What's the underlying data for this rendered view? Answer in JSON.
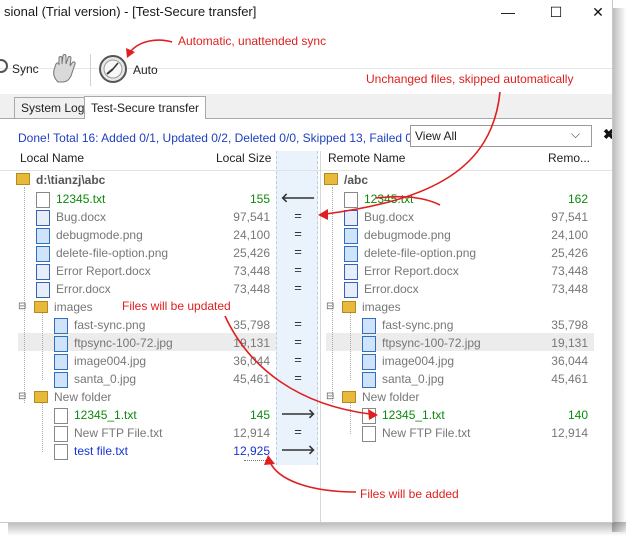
{
  "window": {
    "title": "sional (Trial version) - [Test-Secure transfer]",
    "minimize": "—",
    "maximize": "☐",
    "close": "✕"
  },
  "toolbar": {
    "sync_label": "Sync",
    "auto_label": "Auto"
  },
  "tabs": [
    {
      "label": "System Log"
    },
    {
      "label": "Test-Secure transfer"
    }
  ],
  "status": {
    "text": "Done!  Total 16: Added 0/1, Updated 0/2, Deleted 0/0, Skipped 13, Failed 0",
    "view_option": "View All"
  },
  "columns": {
    "local_name": "Local Name",
    "local_size": "Local Size",
    "remote_name": "Remote Name",
    "remote_size": "Remo..."
  },
  "rows": [
    {
      "local_name": "d:\\tianzj\\abc",
      "local_size": "",
      "mid": "",
      "remote_name": "/abc",
      "remote_size": ""
    },
    {
      "local_name": "12345.txt",
      "local_size": "155",
      "mid": "🡐",
      "remote_name": "12345.txt",
      "remote_size": "162"
    },
    {
      "local_name": "Bug.docx",
      "local_size": "97,541",
      "mid": "=",
      "remote_name": "Bug.docx",
      "remote_size": "97,541"
    },
    {
      "local_name": "debugmode.png",
      "local_size": "24,100",
      "mid": "=",
      "remote_name": "debugmode.png",
      "remote_size": "24,100"
    },
    {
      "local_name": "delete-file-option.png",
      "local_size": "25,426",
      "mid": "=",
      "remote_name": "delete-file-option.png",
      "remote_size": "25,426"
    },
    {
      "local_name": "Error Report.docx",
      "local_size": "73,448",
      "mid": "=",
      "remote_name": "Error Report.docx",
      "remote_size": "73,448"
    },
    {
      "local_name": "Error.docx",
      "local_size": "73,448",
      "mid": "=",
      "remote_name": "Error.docx",
      "remote_size": "73,448"
    },
    {
      "local_name": "images",
      "local_size": "",
      "mid": "",
      "remote_name": "images",
      "remote_size": ""
    },
    {
      "local_name": "fast-sync.png",
      "local_size": "35,798",
      "mid": "=",
      "remote_name": "fast-sync.png",
      "remote_size": "35,798"
    },
    {
      "local_name": "ftpsync-100-72.jpg",
      "local_size": "19,131",
      "mid": "=",
      "remote_name": "ftpsync-100-72.jpg",
      "remote_size": "19,131"
    },
    {
      "local_name": "image004.jpg",
      "local_size": "36,044",
      "mid": "=",
      "remote_name": "image004.jpg",
      "remote_size": "36,044"
    },
    {
      "local_name": "santa_0.jpg",
      "local_size": "45,461",
      "mid": "=",
      "remote_name": "santa_0.jpg",
      "remote_size": "45,461"
    },
    {
      "local_name": "New folder",
      "local_size": "",
      "mid": "",
      "remote_name": "New folder",
      "remote_size": ""
    },
    {
      "local_name": "12345_1.txt",
      "local_size": "145",
      "mid": "🡒",
      "remote_name": "12345_1.txt",
      "remote_size": "140"
    },
    {
      "local_name": "New FTP File.txt",
      "local_size": "12,914",
      "mid": "=",
      "remote_name": "New FTP File.txt",
      "remote_size": "12,914"
    },
    {
      "local_name": "test file.txt",
      "local_size": "12,925",
      "mid": "🡒",
      "remote_name": "",
      "remote_size": ""
    }
  ],
  "annotations": {
    "auto_sync": "Automatic, unattended sync",
    "unchanged": "Unchanged files, skipped automatically",
    "updated": "Files will be updated",
    "added": "Files will be added"
  },
  "colors": {
    "status_blue": "#1f3fbf",
    "updated_green": "#0b8a0b",
    "added_blue": "#1533d6",
    "annotation_red": "#e02020",
    "folder_yellow": "#e8b93a"
  }
}
